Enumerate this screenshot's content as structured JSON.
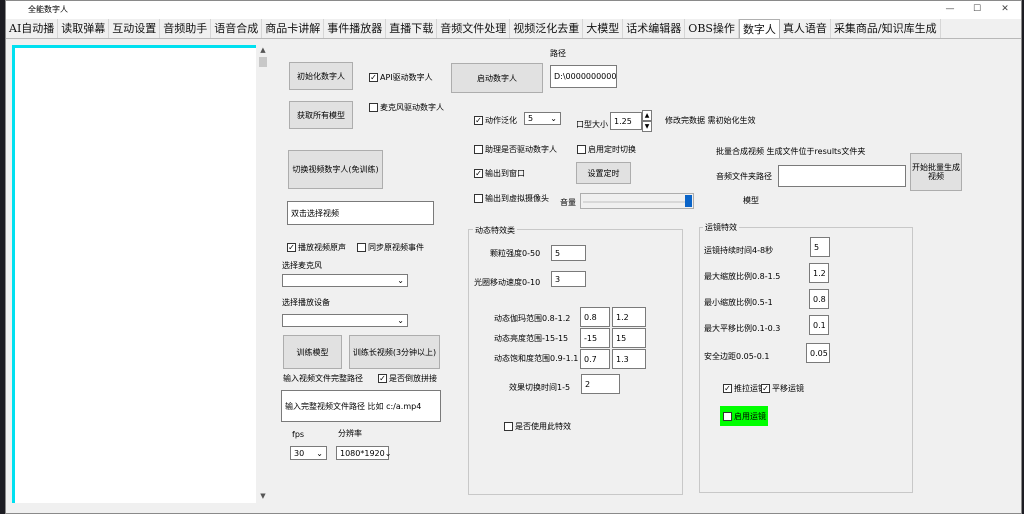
{
  "window": {
    "title": "全能数字人",
    "controls": [
      "—",
      "☐",
      "✕"
    ]
  },
  "tabs": [
    "AI自动播",
    "读取弹幕",
    "互动设置",
    "音频助手",
    "语音合成",
    "商品卡讲解",
    "事件播放器",
    "直播下载",
    "音频文件处理",
    "视频泛化去重",
    "大模型",
    "话术编辑器",
    "OBS操作",
    "数字人",
    "真人语音",
    "采集商品/知识库生成"
  ],
  "left": {
    "init_btn": "初始化数字人",
    "api_drive": "API驱动数字人",
    "start_btn": "启动数字人",
    "path_label": "路径",
    "path_value": "D:\\000000000000\\",
    "get_models_btn": "获取所有模型",
    "mic_drive": "麦克风驱动数字人",
    "switch_btn": "切换视频数字人(免训练)",
    "video_select": "双击选择视频",
    "play_orig": "播放视频原声",
    "sync_event": "同步原视频事件",
    "mic_label": "选择麦克风",
    "device_label": "选择播放设备",
    "train_btn": "训练模型",
    "train_long_btn": "训练长视频(3分钟以上)",
    "input_path_label": "输入视频文件完整路径",
    "reverse_splice": "是否倒放拼接",
    "path_input_value": "输入完整视频文件路径 比如 c:/a.mp4",
    "fps_label": "fps",
    "fps_value": "30",
    "res_label": "分辨率",
    "res_value": "1080*1920"
  },
  "middle": {
    "motion_label": "动作泛化",
    "motion_value": "5",
    "mouth_label": "口型大小",
    "mouth_value": "1.25",
    "modify_note": "修改完数据 需初始化生效",
    "helper_drive": "助理是否驱动数字人",
    "timer_switch": "启用定时切换",
    "output_window": "输出到窗口",
    "timer_btn": "设置定时",
    "virtual_cam": "输出到虚拟摄像头",
    "volume_label": "音量",
    "effects_title": "动态特效类",
    "particle_label": "颗粒强度0-50",
    "particle_value": "5",
    "halo_label": "光圈移动速度0-10",
    "halo_value": "3",
    "gamma_label": "动态伽玛范围0.8-1.2",
    "gamma_min": "0.8",
    "gamma_max": "1.2",
    "bright_label": "动态亮度范围-15-15",
    "bright_min": "-15",
    "bright_max": "15",
    "sat_label": "动态饱和度范围0.9-1.1",
    "sat_min": "0.7",
    "sat_max": "1.3",
    "switch_time_label": "效果切换时间1-5",
    "switch_time_value": "2",
    "use_effect": "是否使用此特效"
  },
  "right": {
    "batch_note": "批量合成视频 生成文件位于results文件夹",
    "audio_folder_label": "音频文件夹路径",
    "audio_folder_value": "",
    "batch_btn": "开始批量生成视频",
    "model_label": "模型",
    "mirror_title": "运镜特效",
    "dur_label": "运镜持续时间4-8秒",
    "dur_value": "5",
    "zoom_max_label": "最大缩放比例0.8-1.5",
    "zoom_max_value": "1.2",
    "zoom_min_label": "最小缩放比例0.5-1",
    "zoom_min_value": "0.8",
    "pan_label": "最大平移比例0.1-0.3",
    "pan_value": "0.1",
    "safe_label": "安全边距0.05-0.1",
    "safe_value": "0.05",
    "push_pull": "推拉运镜",
    "pan_mirror": "平移运镜",
    "enable_mirror": "启用运镜"
  },
  "colors": {
    "accent_border": "#00e0f0",
    "enable_green": "#00ff00",
    "background": "#f0f0f0"
  }
}
